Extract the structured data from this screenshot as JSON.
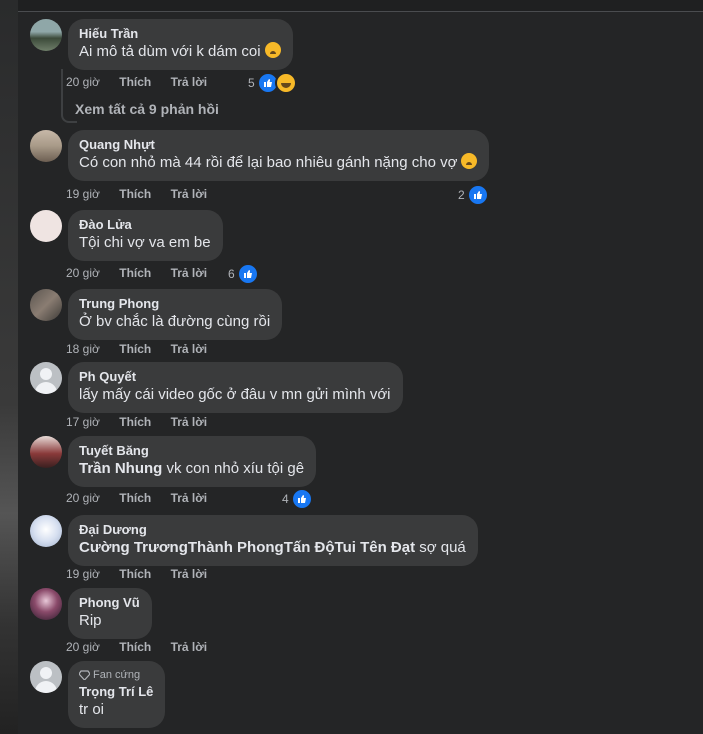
{
  "colors": {
    "background": "#242526",
    "bubble": "#3a3b3c",
    "text": "#e4e6eb",
    "meta": "#b0b3b8",
    "like": "#1877f2"
  },
  "view_replies": "Xem tất cả 9 phản hồi",
  "labels": {
    "like": "Thích",
    "reply": "Trả lời"
  },
  "fan_badge": "Fan cứng",
  "comments": [
    {
      "author": "Hiếu Trần",
      "text": "Ai mô tả dùm với k dám coi",
      "emoji": "face-screaming",
      "time": "20 giờ",
      "reactions": "5",
      "reaction_icons": [
        "like",
        "haha"
      ]
    },
    {
      "author": "Quang Nhựt",
      "text": "Có con nhỏ mà 44 rồi để lại bao nhiêu gánh nặng cho vợ",
      "emoji": "sad-face",
      "time": "19 giờ",
      "reactions": "2",
      "reaction_icons": [
        "like"
      ]
    },
    {
      "author": "Đào Lửa",
      "text": "Tội chi vợ va em be",
      "time": "20 giờ",
      "reactions": "6",
      "reaction_icons": [
        "like"
      ]
    },
    {
      "author": "Trung Phong",
      "text": "Ở bv chắc là đường cùng rồi",
      "time": "18 giờ"
    },
    {
      "author": "Ph Quyết",
      "text": "lấy mấy cái video gốc ở đâu v mn gửi mình với",
      "time": "17 giờ"
    },
    {
      "author": "Tuyết Băng",
      "mention": "Trần Nhung",
      "text": " vk con nhỏ xíu tội gê",
      "time": "20 giờ",
      "reactions": "4",
      "reaction_icons": [
        "like"
      ]
    },
    {
      "author": "Đại Dương",
      "mention": "Cường TrươngThành PhongTấn ĐộTui Tên Đạt",
      "text": " sợ quá",
      "time": "19 giờ"
    },
    {
      "author": "Phong Vũ",
      "text": "Rip",
      "time": "20 giờ"
    },
    {
      "author": "Trọng Trí Lê",
      "text": "tr oi"
    }
  ]
}
